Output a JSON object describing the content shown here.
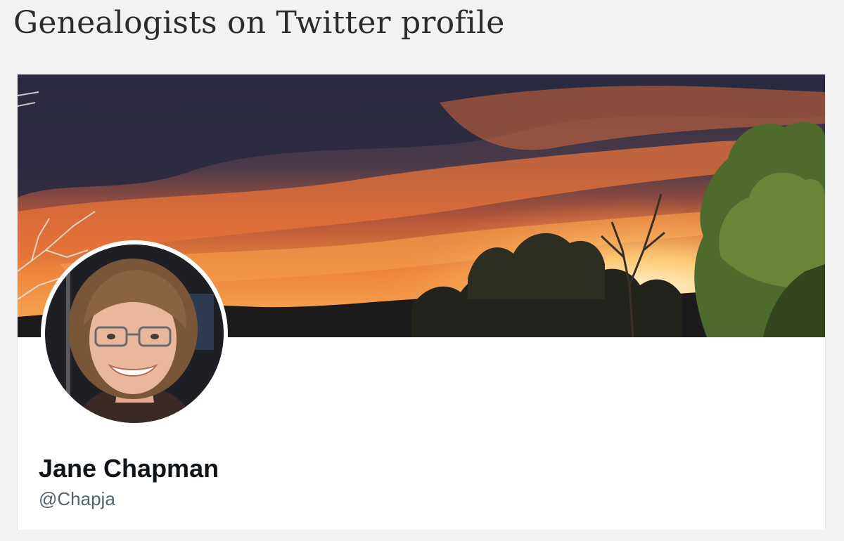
{
  "page": {
    "title": "Genealogists on Twitter profile"
  },
  "profile": {
    "display_name": "Jane Chapman",
    "handle": "@Chapja",
    "banner_image": "sunset-landscape-with-trees",
    "avatar_image": "woman-with-glasses-smiling"
  },
  "colors": {
    "page_background": "#f2f2f2",
    "card_background": "#ffffff",
    "name_text": "#0f1419",
    "handle_text": "#536471",
    "sunset_orange": "#f08a3c"
  }
}
